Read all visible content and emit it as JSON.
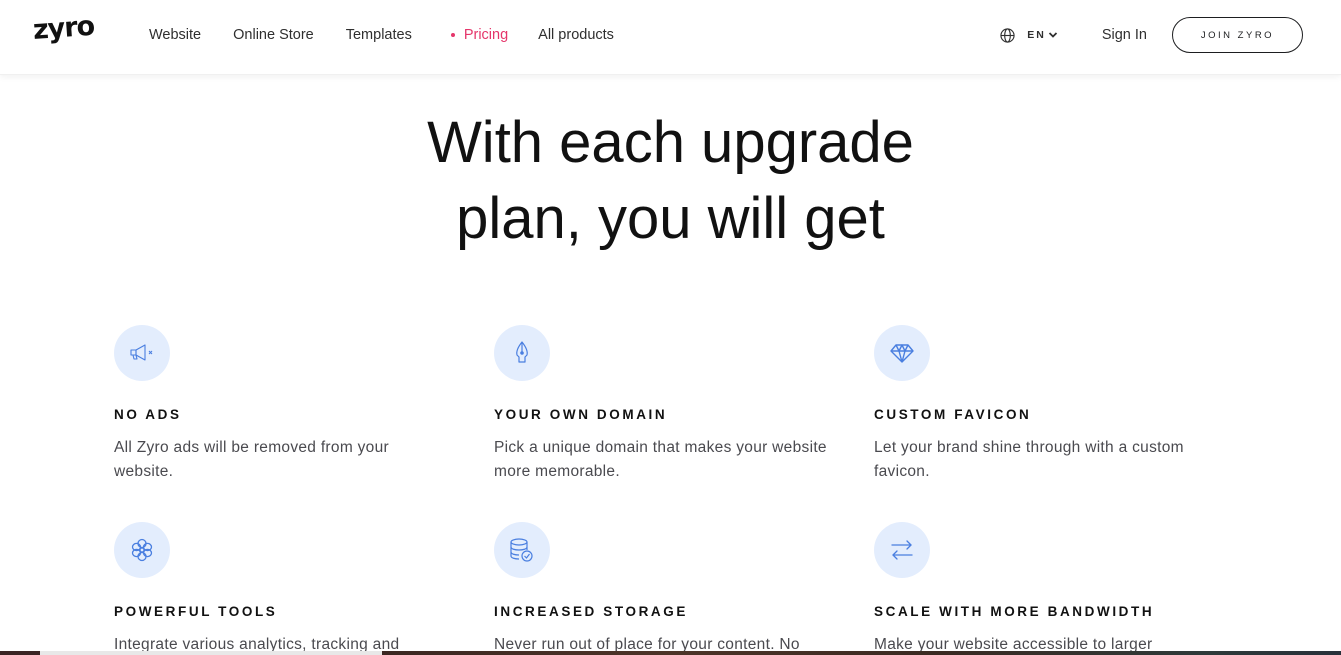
{
  "header": {
    "logo": "zyro",
    "nav": [
      {
        "label": "Website",
        "active": false
      },
      {
        "label": "Online Store",
        "active": false
      },
      {
        "label": "Templates",
        "active": false
      },
      {
        "label": "Pricing",
        "active": true
      },
      {
        "label": "All products",
        "active": false
      }
    ],
    "language": {
      "icon": "globe-icon",
      "code": "EN"
    },
    "sign_in": "Sign In",
    "join_button": "JOIN ZYRO"
  },
  "hero": {
    "title_line1": "With each upgrade",
    "title_line2": "plan, you will get"
  },
  "features": [
    {
      "icon": "megaphone-off-icon",
      "title": "NO ADS",
      "description": "All Zyro ads will be removed from your website."
    },
    {
      "icon": "pen-nib-icon",
      "title": "YOUR OWN DOMAIN",
      "description": "Pick a unique domain that makes your website more memorable."
    },
    {
      "icon": "diamond-icon",
      "title": "CUSTOM FAVICON",
      "description": "Let your brand shine through with a custom favicon."
    },
    {
      "icon": "flower-tools-icon",
      "title": "POWERFUL TOOLS",
      "description": "Integrate various analytics, tracking and"
    },
    {
      "icon": "database-check-icon",
      "title": "INCREASED STORAGE",
      "description": "Never run out of place for your content. No"
    },
    {
      "icon": "arrows-exchange-icon",
      "title": "SCALE WITH MORE BANDWIDTH",
      "description": "Make your website accessible to larger"
    }
  ],
  "colors": {
    "accent_pink": "#e5366b",
    "icon_blue": "#4a7fe0",
    "icon_bg": "#e3edfd",
    "text_dark": "#111111"
  }
}
